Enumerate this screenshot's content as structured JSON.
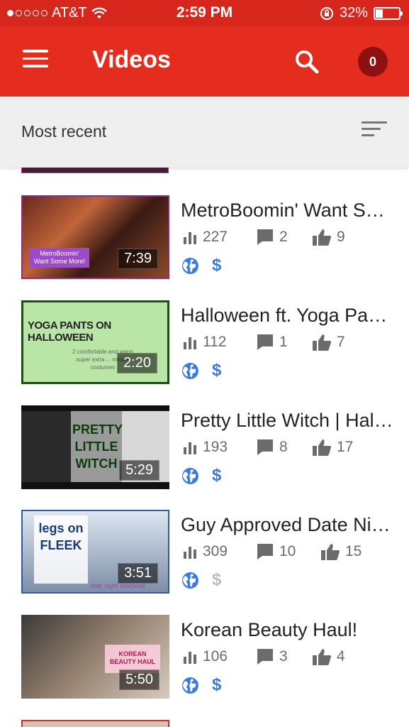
{
  "status_bar": {
    "carrier": "AT&T",
    "time": "2:59 PM",
    "battery_percent": "32%",
    "battery_level": 0.32,
    "signal_bars_filled": 1,
    "signal_bars_total": 5
  },
  "app_bar": {
    "title": "Videos",
    "notification_count": "0",
    "color": "#e52d1f"
  },
  "sort_bar": {
    "label": "Most recent"
  },
  "videos": [
    {
      "title": "MetroBoomin' Want Some More!",
      "duration": "7:39",
      "views": "227",
      "comments": "2",
      "likes": "9",
      "public": true,
      "monetized": true,
      "thumb_text": "MetroBoomin' Want Some More!"
    },
    {
      "title": "Halloween ft. Yoga Pants",
      "duration": "2:20",
      "views": "112",
      "comments": "1",
      "likes": "7",
      "public": true,
      "monetized": true,
      "thumb_text": "YOGA PANTS ON HALLOWEEN",
      "thumb_subtext": "2 comfortable and warm super extra ... minute costumes"
    },
    {
      "title": "Pretty Little Witch | Halloween",
      "duration": "5:29",
      "views": "193",
      "comments": "8",
      "likes": "17",
      "public": true,
      "monetized": true,
      "thumb_text": "PRETTY LITTLE WITCH"
    },
    {
      "title": "Guy Approved Date Night Lookbook",
      "duration": "3:51",
      "views": "309",
      "comments": "10",
      "likes": "15",
      "public": true,
      "monetized": false,
      "thumb_text": "legs on FLEEK",
      "thumb_subtext": "date night lookbook"
    },
    {
      "title": "Korean Beauty Haul!",
      "duration": "5:50",
      "views": "106",
      "comments": "3",
      "likes": "4",
      "public": true,
      "monetized": true,
      "thumb_text": "KOREAN BEAUTY HAUL"
    }
  ],
  "icons": {
    "menu": "menu-icon",
    "search": "search-icon",
    "sort": "sort-icon",
    "views": "bar-chart-icon",
    "comments": "comment-icon",
    "likes": "thumbs-up-icon",
    "public": "globe-icon",
    "monetized": "dollar-icon"
  },
  "colors": {
    "status_bar": "#d7261c",
    "accent_blue": "#3b7be0",
    "disabled_gray": "#bcbcbc"
  }
}
